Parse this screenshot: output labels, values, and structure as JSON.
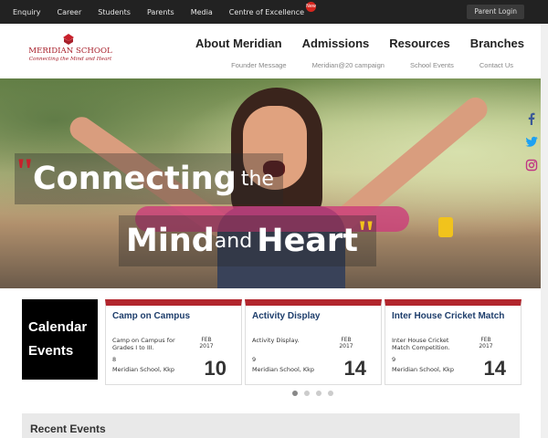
{
  "topbar": {
    "links": [
      "Enquiry",
      "Career",
      "Students",
      "Parents",
      "Media",
      "Centre of Excellence"
    ],
    "new_badge": "New",
    "parent_login": "Parent Login"
  },
  "logo": {
    "name": "MERIDIAN SCHOOL",
    "tagline": "Connecting the Mind and Heart"
  },
  "main_nav": [
    "About Meridian",
    "Admissions",
    "Resources",
    "Branches"
  ],
  "sub_nav": [
    "Founder Message",
    "Meridian@20 campaign",
    "School Events",
    "Contact Us"
  ],
  "hero": {
    "line1_big": "Connecting",
    "line1_small": "the",
    "line2_big1": "Mind",
    "line2_small": "and",
    "line2_big2": "Heart",
    "quote_open": "\"",
    "quote_close": "\""
  },
  "social_icons": [
    "facebook-icon",
    "twitter-icon",
    "instagram-icon"
  ],
  "calendar": {
    "line1": "Calendar",
    "line2": "Events"
  },
  "events": [
    {
      "title": "Camp on Campus",
      "desc": "Camp on Campus for Grades I to III.",
      "day": "8",
      "location": "Meridian School, Kkp",
      "month": "FEB",
      "year": "2017",
      "date": "10"
    },
    {
      "title": "Activity Display",
      "desc": "Activity Display.",
      "day": "9",
      "location": "Meridian School, Kkp",
      "month": "FEB",
      "year": "2017",
      "date": "14"
    },
    {
      "title": "Inter House Cricket Match",
      "desc": "Inter House Cricket Match Competition.",
      "day": "9",
      "location": "Meridian School, Kkp",
      "month": "FEB",
      "year": "2017",
      "date": "14"
    }
  ],
  "carousel": {
    "count": 4,
    "active_index": 0
  },
  "recent_events": {
    "heading": "Recent Events"
  },
  "colors": {
    "brand_red": "#b2262d",
    "title_blue": "#1d3d6b",
    "accent_yellow": "#f2c21b"
  }
}
